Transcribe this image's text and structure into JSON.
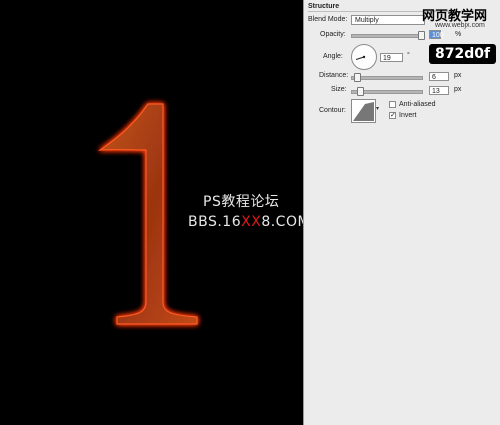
{
  "canvas": {
    "glyph": "1",
    "watermark_line1": "PS教程论坛",
    "watermark_line2_prefix": "BBS.16",
    "watermark_line2_red": "XX",
    "watermark_line2_suffix": "8.COM"
  },
  "panel": {
    "section_title": "Structure",
    "blend_mode": {
      "label": "Blend Mode:",
      "value": "Multiply"
    },
    "opacity": {
      "label": "Opacity:",
      "value": "100",
      "unit": "%"
    },
    "angle": {
      "label": "Angle:",
      "value": "19",
      "unit": "°"
    },
    "distance": {
      "label": "Distance:",
      "value": "6",
      "unit": "px"
    },
    "size": {
      "label": "Size:",
      "value": "13",
      "unit": "px"
    },
    "contour": {
      "label": "Contour:",
      "arrow": "▾"
    },
    "anti_aliased": {
      "label": "Anti-aliased",
      "checked": false
    },
    "invert": {
      "label": "Invert",
      "checked": true,
      "mark": "✓"
    }
  },
  "branding": {
    "site_name": "网页教学网",
    "site_url": "www.webjx.com",
    "badge": "872d0f"
  },
  "colors": {
    "glyph_fill": "#a83a14",
    "glyph_glow": "#ff3a10",
    "watermark_red": "#e01818",
    "panel_bg": "#ececec"
  }
}
